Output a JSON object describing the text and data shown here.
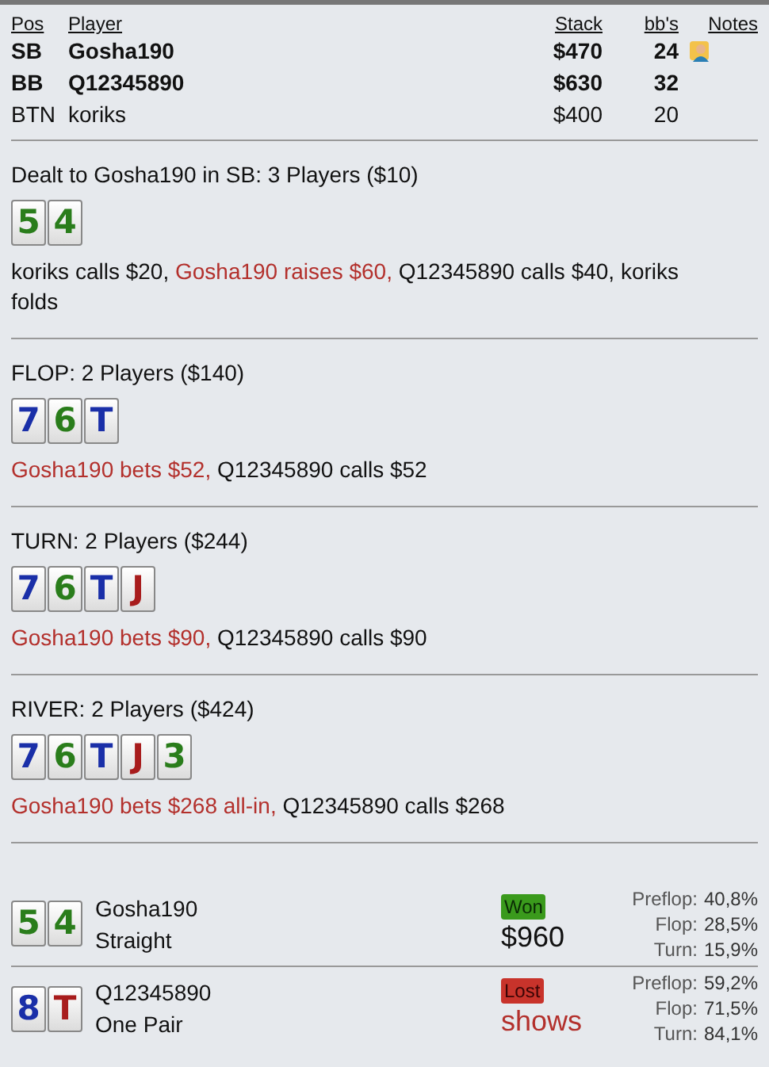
{
  "header": {
    "columns": [
      "Pos",
      "Player",
      "Stack",
      "bb's",
      "Notes"
    ]
  },
  "players": [
    {
      "pos": "SB",
      "name": "Gosha190",
      "stack": "$470",
      "bbs": "24",
      "bold": true,
      "note": true
    },
    {
      "pos": "BB",
      "name": "Q12345890",
      "stack": "$630",
      "bbs": "32",
      "bold": true,
      "note": false
    },
    {
      "pos": "BTN",
      "name": "koriks",
      "stack": "$400",
      "bbs": "20",
      "bold": false,
      "note": false
    }
  ],
  "streets": [
    {
      "title": "Dealt to Gosha190 in SB: 3 Players ($10)",
      "cards": [
        {
          "rank": "5",
          "color": "#2a7d1b"
        },
        {
          "rank": "4",
          "color": "#2a7d1b"
        }
      ],
      "actions": [
        {
          "text": "koriks calls $20, ",
          "hero": false
        },
        {
          "text": "Gosha190 raises $60, ",
          "hero": true
        },
        {
          "text": "Q12345890 calls $40, koriks folds",
          "hero": false
        }
      ]
    },
    {
      "title": "FLOP: 2 Players ($140)",
      "cards": [
        {
          "rank": "7",
          "color": "#1a2fa8"
        },
        {
          "rank": "6",
          "color": "#2a7d1b"
        },
        {
          "rank": "T",
          "color": "#1a2fa8"
        }
      ],
      "actions": [
        {
          "text": "Gosha190 bets $52, ",
          "hero": true
        },
        {
          "text": "Q12345890 calls $52",
          "hero": false
        }
      ]
    },
    {
      "title": "TURN: 2 Players ($244)",
      "cards": [
        {
          "rank": "7",
          "color": "#1a2fa8"
        },
        {
          "rank": "6",
          "color": "#2a7d1b"
        },
        {
          "rank": "T",
          "color": "#1a2fa8"
        },
        {
          "rank": "J",
          "color": "#a81c1c"
        }
      ],
      "actions": [
        {
          "text": "Gosha190 bets $90, ",
          "hero": true
        },
        {
          "text": "Q12345890 calls $90",
          "hero": false
        }
      ]
    },
    {
      "title": "RIVER: 2 Players ($424)",
      "cards": [
        {
          "rank": "7",
          "color": "#1a2fa8"
        },
        {
          "rank": "6",
          "color": "#2a7d1b"
        },
        {
          "rank": "T",
          "color": "#1a2fa8"
        },
        {
          "rank": "J",
          "color": "#a81c1c"
        },
        {
          "rank": "3",
          "color": "#2a7d1b"
        }
      ],
      "actions": [
        {
          "text": "Gosha190 bets $268 all-in, ",
          "hero": true
        },
        {
          "text": "Q12345890 calls $268",
          "hero": false
        }
      ]
    }
  ],
  "results": [
    {
      "cards": [
        {
          "rank": "5",
          "color": "#2a7d1b"
        },
        {
          "rank": "4",
          "color": "#2a7d1b"
        }
      ],
      "name": "Gosha190",
      "hand": "Straight",
      "kind": "won",
      "badge": "Won",
      "amount": "$960",
      "equity": [
        {
          "label": "Preflop:",
          "value": "40,8%"
        },
        {
          "label": "Flop:",
          "value": "28,5%"
        },
        {
          "label": "Turn:",
          "value": "15,9%"
        }
      ]
    },
    {
      "cards": [
        {
          "rank": "8",
          "color": "#1a2fa8"
        },
        {
          "rank": "T",
          "color": "#a81c1c"
        }
      ],
      "name": "Q12345890",
      "hand": "One Pair",
      "kind": "lost",
      "badge": "Lost",
      "amount": "shows",
      "equity": [
        {
          "label": "Preflop:",
          "value": "59,2%"
        },
        {
          "label": "Flop:",
          "value": "71,5%"
        },
        {
          "label": "Turn:",
          "value": "84,1%"
        }
      ]
    }
  ]
}
